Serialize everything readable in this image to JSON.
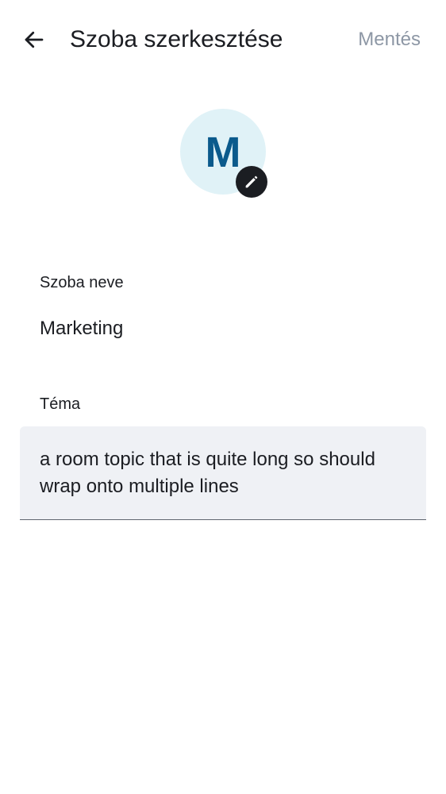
{
  "header": {
    "back_icon": "arrow-left-icon",
    "title": "Szoba szerkesztése",
    "save_label": "Mentés"
  },
  "avatar": {
    "initial": "M",
    "edit_icon": "pencil-icon",
    "background_color": "#e0f2f7",
    "initial_color": "#0a5a8c"
  },
  "form": {
    "name_label": "Szoba neve",
    "name_value": "Marketing",
    "topic_label": "Téma",
    "topic_value": "a room topic that is quite long so should wrap onto multiple lines"
  },
  "colors": {
    "text": "#1b1d22",
    "save_disabled": "#8d97a5",
    "field_background": "#eff1f5"
  }
}
